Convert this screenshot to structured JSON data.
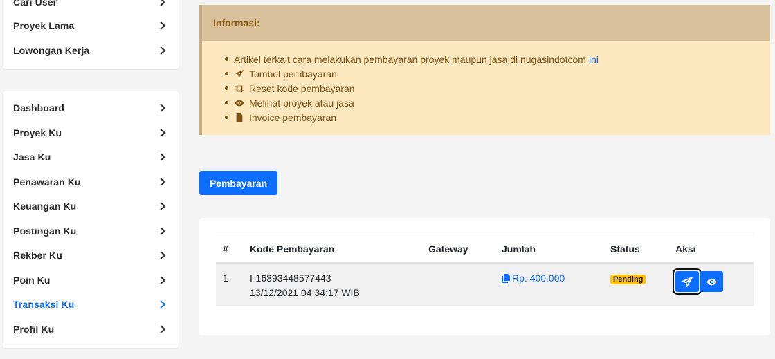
{
  "sidebar_top": {
    "items": [
      {
        "label": "Cari User"
      },
      {
        "label": "Proyek Lama"
      },
      {
        "label": "Lowongan Kerja"
      }
    ]
  },
  "sidebar_main": {
    "items": [
      {
        "label": "Dashboard"
      },
      {
        "label": "Proyek Ku"
      },
      {
        "label": "Jasa Ku"
      },
      {
        "label": "Penawaran Ku"
      },
      {
        "label": "Keuangan Ku"
      },
      {
        "label": "Postingan Ku"
      },
      {
        "label": "Rekber Ku"
      },
      {
        "label": "Poin Ku"
      },
      {
        "label": "Transaksi Ku",
        "active": true
      },
      {
        "label": "Profil Ku"
      }
    ]
  },
  "info": {
    "title": "Informasi:",
    "items": [
      {
        "text": "Artikel terkait cara melakukan pembayaran proyek maupun jasa di nugasindotcom",
        "link": "ini",
        "icon": "none"
      },
      {
        "text": "Tombol pembayaran",
        "icon": "paper-plane-icon"
      },
      {
        "text": "Reset kode pembayaran",
        "icon": "retweet-icon"
      },
      {
        "text": "Melihat proyek atau jasa",
        "icon": "eye-icon"
      },
      {
        "text": "Invoice pembayaran",
        "icon": "file-icon"
      }
    ]
  },
  "pay_button": {
    "label": "Pembayaran"
  },
  "table": {
    "headers": {
      "num": "#",
      "kode": "Kode Pembayaran",
      "gateway": "Gateway",
      "jumlah": "Jumlah",
      "status": "Status",
      "aksi": "Aksi"
    },
    "rows": [
      {
        "num": "1",
        "kode": "I-16393448577443",
        "date": "13/12/2021 04:34:17 WIB",
        "gateway": "",
        "jumlah": "Rp. 400.000",
        "status": "Pending"
      }
    ]
  },
  "colors": {
    "accent": "#0d6efd",
    "info_bg": "#fde7bf",
    "info_header": "#d9c19c",
    "info_text": "#7a5215",
    "badge": "#ffc107"
  }
}
